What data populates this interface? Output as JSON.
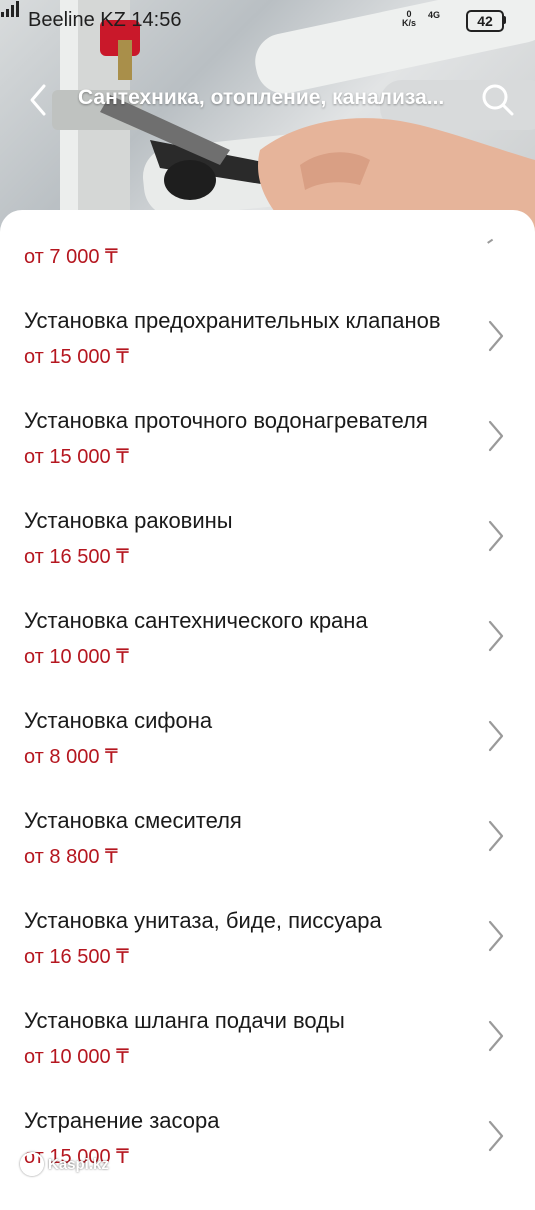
{
  "status_bar": {
    "carrier_time": "Beeline KZ 14:56",
    "net_speed_value": "0",
    "net_speed_unit": "K/s",
    "network_type": "4G",
    "battery": "42"
  },
  "header": {
    "title": "Сантехника, отопление, канализа...",
    "back_icon": "chevron-left-icon",
    "search_icon": "search-icon"
  },
  "top_item": {
    "price": "от 7 000 ₸"
  },
  "services": [
    {
      "title": "Установка предохранительных клапанов",
      "price": "от 15 000 ₸"
    },
    {
      "title": "Установка проточного водонагревателя",
      "price": "от 15 000 ₸"
    },
    {
      "title": "Установка раковины",
      "price": "от 16 500 ₸"
    },
    {
      "title": "Установка сантехнического крана",
      "price": "от 10 000 ₸"
    },
    {
      "title": "Установка сифона",
      "price": "от 8 000 ₸"
    },
    {
      "title": "Установка смесителя",
      "price": "от 8 800 ₸"
    },
    {
      "title": "Установка унитаза, биде, писсуара",
      "price": "от 16 500 ₸"
    },
    {
      "title": "Установка шланга подачи воды",
      "price": "от 10 000 ₸"
    },
    {
      "title": "Устранение засора",
      "price": "от 15 000 ₸"
    }
  ],
  "watermark": "Kaspi.kz",
  "colors": {
    "price": "#b5161f",
    "title": "#1a1a1a",
    "chevron": "#9a9a9a"
  }
}
